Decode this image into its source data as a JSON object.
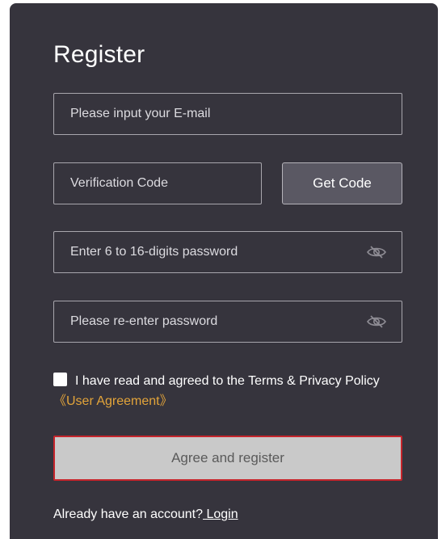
{
  "form": {
    "title": "Register",
    "email": {
      "placeholder": "Please input your E-mail",
      "value": ""
    },
    "code": {
      "placeholder": "Verification Code",
      "value": ""
    },
    "get_code_label": "Get Code",
    "password": {
      "placeholder": "Enter 6 to 16-digits password",
      "value": ""
    },
    "repassword": {
      "placeholder": "Please re-enter password",
      "value": ""
    },
    "agree_text": "I have read and agreed to the Terms & Privacy Policy",
    "agreement_link": "《User Agreement》",
    "register_label": "Agree and register",
    "login_prompt": "Already have an account?",
    "login_link": " Login"
  },
  "icons": {
    "password_toggle": "eye-slash-icon",
    "repassword_toggle": "eye-slash-icon"
  },
  "colors": {
    "panel_bg": "#36343d",
    "accent_link": "#e3a43a",
    "button_border": "#c6242b"
  }
}
